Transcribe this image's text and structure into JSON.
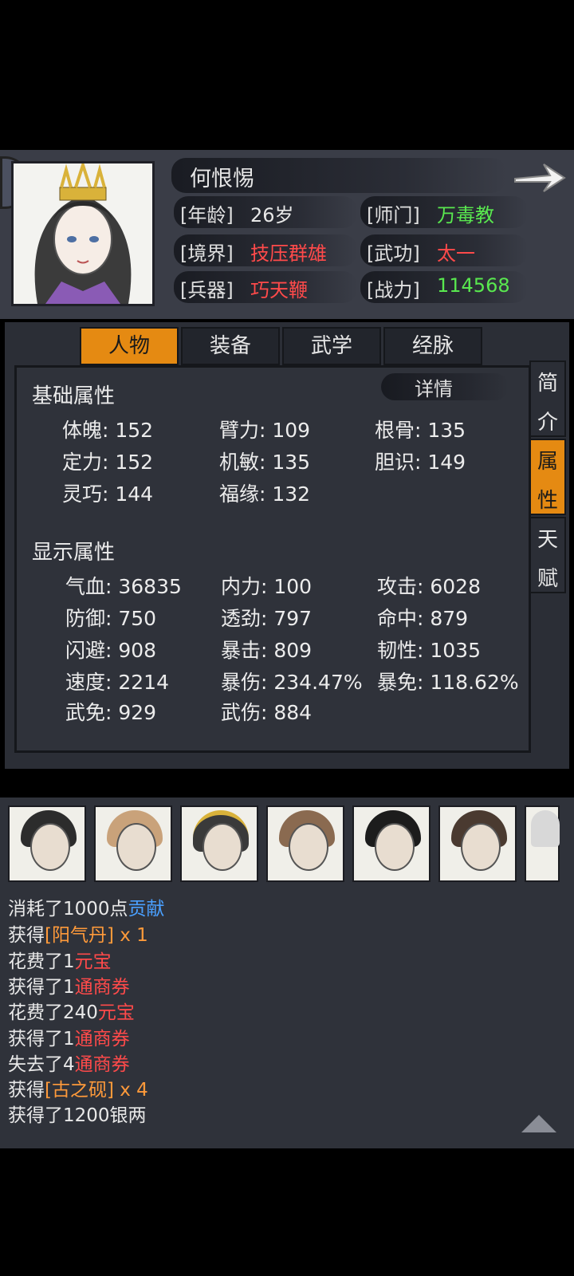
{
  "character": {
    "name": "何恨惕",
    "info": [
      {
        "label": "[年龄]",
        "value": "26岁",
        "color": "#e8e8e8"
      },
      {
        "label": "[师门]",
        "value": "万毒教",
        "color": "#59e84f"
      },
      {
        "label": "[境界]",
        "value": "技压群雄",
        "color": "#ff4a4a"
      },
      {
        "label": "[武功]",
        "value": "太一",
        "color": "#ff4a4a"
      },
      {
        "label": "[兵器]",
        "value": "巧天鞭",
        "color": "#ff4a4a"
      },
      {
        "label": "[战力]",
        "value": "114568",
        "color": "#59e84f"
      }
    ]
  },
  "tabs": [
    "人物",
    "装备",
    "武学",
    "经脉"
  ],
  "active_tab": "人物",
  "side_tabs": [
    {
      "label": "简介",
      "chars": [
        "简",
        "介"
      ],
      "active": false
    },
    {
      "label": "属性",
      "chars": [
        "属",
        "性"
      ],
      "active": true
    },
    {
      "label": "天赋",
      "chars": [
        "天",
        "赋"
      ],
      "active": false
    }
  ],
  "detail_label": "详情",
  "basic": {
    "title": "基础属性",
    "stats": [
      "体魄: 152",
      "臂力: 109",
      "根骨: 135",
      "定力: 152",
      "机敏: 135",
      "胆识: 149",
      "灵巧: 144",
      "福缘: 132"
    ]
  },
  "display": {
    "title": "显示属性",
    "stats": [
      "气血: 36835",
      "内力: 100",
      "攻击: 6028",
      "防御: 750",
      "透劲: 797",
      "命中: 879",
      "闪避: 908",
      "暴击: 809",
      "韧性: 1035",
      "速度: 2214",
      "暴伤: 234.47%",
      "暴免: 118.62%",
      "武免: 929",
      "武伤: 884"
    ]
  },
  "portrait_icons": [
    "portrait-icon",
    "scholar-fan-icon",
    "fur-hat-warrior-icon",
    "crowned-lady-icon",
    "flower-lady-icon",
    "swordsman-icon",
    "maiden-icon",
    "white-hair-icon"
  ],
  "log": [
    [
      {
        "t": "消耗了1000点",
        "c": "white"
      },
      {
        "t": "贡献",
        "c": "blue"
      }
    ],
    [
      {
        "t": "获得",
        "c": "white"
      },
      {
        "t": "[阳气丹]",
        "c": "orange"
      },
      {
        "t": " x 1",
        "c": "orange"
      }
    ],
    [
      {
        "t": "花费了1",
        "c": "white"
      },
      {
        "t": "元宝",
        "c": "red"
      }
    ],
    [
      {
        "t": "获得了1",
        "c": "white"
      },
      {
        "t": "通商券",
        "c": "red"
      }
    ],
    [
      {
        "t": "花费了240",
        "c": "white"
      },
      {
        "t": "元宝",
        "c": "red"
      }
    ],
    [
      {
        "t": "获得了1",
        "c": "white"
      },
      {
        "t": "通商券",
        "c": "red"
      }
    ],
    [
      {
        "t": "失去了4",
        "c": "white"
      },
      {
        "t": "通商券",
        "c": "red"
      }
    ],
    [
      {
        "t": "获得",
        "c": "white"
      },
      {
        "t": "[古之砚]",
        "c": "orange"
      },
      {
        "t": " x 4",
        "c": "orange"
      }
    ],
    [
      {
        "t": "获得了1200银两",
        "c": "white"
      }
    ]
  ]
}
